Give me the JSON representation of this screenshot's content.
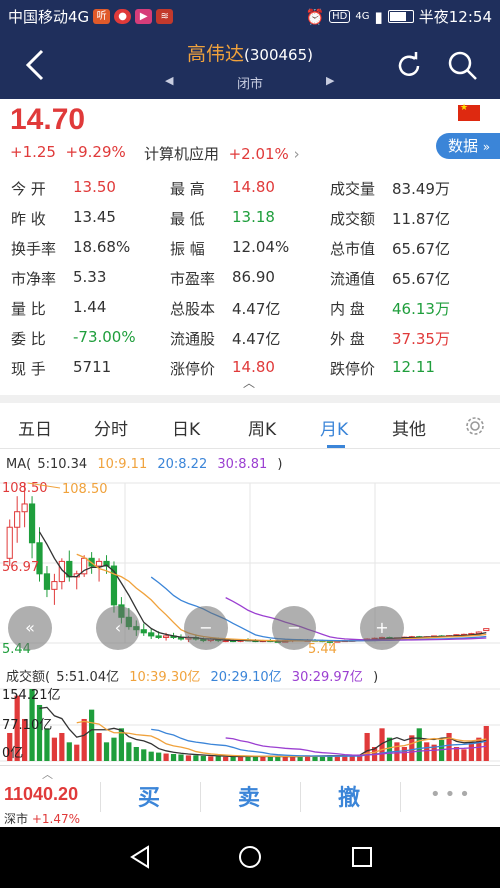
{
  "status_bar": {
    "carrier": "中国移动4G",
    "time": "半夜12:54",
    "hd": "HD",
    "net": "4G"
  },
  "header": {
    "title": "高伟达",
    "code": "(300465)",
    "market_status": "闭市"
  },
  "quote": {
    "price": "14.70",
    "change": "+1.25",
    "change_pct": "+9.29%",
    "sector_name": "计算机应用",
    "sector_pct": "+2.01%",
    "data_button": "数据"
  },
  "stats": [
    [
      {
        "label": "今 开",
        "value": "13.50",
        "color": "red"
      },
      {
        "label": "最 高",
        "value": "14.80",
        "color": "red"
      },
      {
        "label": "成交量",
        "value": "83.49万",
        "color": "none"
      }
    ],
    [
      {
        "label": "昨 收",
        "value": "13.45",
        "color": "none"
      },
      {
        "label": "最 低",
        "value": "13.18",
        "color": "green"
      },
      {
        "label": "成交额",
        "value": "11.87亿",
        "color": "none"
      }
    ],
    [
      {
        "label": "换手率",
        "value": "18.68%",
        "color": "none"
      },
      {
        "label": "振 幅",
        "value": "12.04%",
        "color": "none"
      },
      {
        "label": "总市值",
        "value": "65.67亿",
        "color": "none"
      }
    ],
    [
      {
        "label": "市净率",
        "value": "5.33",
        "color": "none"
      },
      {
        "label": "市盈率",
        "value": "86.90",
        "color": "none"
      },
      {
        "label": "流通值",
        "value": "65.67亿",
        "color": "none"
      }
    ],
    [
      {
        "label": "量 比",
        "value": "1.44",
        "color": "none"
      },
      {
        "label": "总股本",
        "value": "4.47亿",
        "color": "none"
      },
      {
        "label": "内 盘",
        "value": "46.13万",
        "color": "green"
      }
    ],
    [
      {
        "label": "委 比",
        "value": "-73.00%",
        "color": "green"
      },
      {
        "label": "流通股",
        "value": "4.47亿",
        "color": "none"
      },
      {
        "label": "外 盘",
        "value": "37.35万",
        "color": "red"
      }
    ],
    [
      {
        "label": "现 手",
        "value": "5711",
        "color": "none"
      },
      {
        "label": "涨停价",
        "value": "14.80",
        "color": "red"
      },
      {
        "label": "跌停价",
        "value": "12.11",
        "color": "green"
      }
    ]
  ],
  "tabs": [
    "五日",
    "分时",
    "日K",
    "周K",
    "月K",
    "其他"
  ],
  "active_tab": "月K",
  "ma_legend": {
    "prefix": "MA(",
    "ma5": "5:10.34",
    "ma10": "10:9.11",
    "ma20": "20:8.22",
    "ma30": "30:8.81",
    "suffix": ")"
  },
  "chart_labels": {
    "high_axis": "108.50",
    "high_mark": "108.50",
    "mid_axis": "56.97",
    "low_axis": "5.44",
    "low_mark": "5.44"
  },
  "vol_legend": {
    "prefix": "成交额(",
    "v5": "5:51.04亿",
    "v10": "10:39.30亿",
    "v20": "20:29.10亿",
    "v30": "30:29.97亿",
    "suffix": ")"
  },
  "vol_labels": {
    "top": "154.21亿",
    "mid": "77.10亿",
    "low": "0亿"
  },
  "bottom": {
    "index_value": "11040.20",
    "index_name": "深市",
    "index_pct": "+1.47%",
    "buy": "买",
    "sell": "卖",
    "cancel": "撤",
    "more": "•••"
  },
  "colors": {
    "up": "#e03a3a",
    "down": "#1f9e3c",
    "ma5": "#333333",
    "ma10": "#f0a23c",
    "ma20": "#3b85d8",
    "ma30": "#9b3fd1",
    "nav_bg": "#1f2f5c",
    "accent": "#3b85d8"
  },
  "chart_data": {
    "type": "candlestick",
    "x": [
      1,
      2,
      3,
      4,
      5,
      6,
      7,
      8,
      9,
      10,
      11,
      12,
      13,
      14,
      15,
      16,
      17,
      18,
      19,
      20,
      21,
      22,
      23,
      24,
      25,
      26,
      27,
      28,
      29,
      30,
      31,
      32,
      33,
      34,
      35,
      36,
      37,
      38,
      39,
      40,
      41,
      42,
      43,
      44,
      45,
      46,
      47,
      48,
      49,
      50,
      51,
      52,
      53,
      54,
      55,
      56,
      57,
      58,
      59,
      60,
      61,
      62,
      63,
      64,
      65
    ],
    "ohlc": [
      [
        60,
        85,
        55,
        80
      ],
      [
        80,
        100,
        70,
        90
      ],
      [
        90,
        108.5,
        80,
        95
      ],
      [
        95,
        100,
        60,
        70
      ],
      [
        70,
        80,
        45,
        50
      ],
      [
        50,
        55,
        35,
        40
      ],
      [
        40,
        50,
        30,
        45
      ],
      [
        45,
        60,
        40,
        58
      ],
      [
        58,
        65,
        45,
        48
      ],
      [
        48,
        52,
        40,
        50
      ],
      [
        50,
        62,
        48,
        60
      ],
      [
        60,
        64,
        50,
        55
      ],
      [
        55,
        60,
        45,
        58
      ],
      [
        58,
        62,
        50,
        55
      ],
      [
        55,
        58,
        25,
        30
      ],
      [
        30,
        35,
        18,
        22
      ],
      [
        22,
        28,
        14,
        16
      ],
      [
        16,
        20,
        10,
        14
      ],
      [
        14,
        18,
        10,
        12
      ],
      [
        12,
        15,
        8,
        10
      ],
      [
        10,
        13,
        8,
        9
      ],
      [
        9,
        12,
        7,
        10
      ],
      [
        10,
        12,
        8,
        9
      ],
      [
        9,
        11,
        7,
        8
      ],
      [
        8,
        10,
        6,
        9
      ],
      [
        9,
        11,
        7,
        8
      ],
      [
        8,
        9,
        6,
        7
      ],
      [
        7,
        9,
        6,
        8
      ],
      [
        8,
        9,
        6,
        7
      ],
      [
        7,
        8,
        6,
        7
      ],
      [
        7,
        8,
        6,
        6.5
      ],
      [
        6.5,
        8,
        6,
        7.5
      ],
      [
        7.5,
        8.5,
        6.5,
        7
      ],
      [
        7,
        8,
        6,
        6.5
      ],
      [
        6.5,
        7.5,
        6,
        7
      ],
      [
        7,
        8,
        6,
        6.5
      ],
      [
        6.5,
        7.5,
        5.8,
        6
      ],
      [
        6,
        7.5,
        5.8,
        7
      ],
      [
        7,
        8,
        6,
        7.5
      ],
      [
        7.5,
        8,
        6.5,
        7
      ],
      [
        7,
        8,
        6.5,
        7.2
      ],
      [
        7.2,
        8,
        6.5,
        7
      ],
      [
        7,
        7.5,
        6,
        6.5
      ],
      [
        6.5,
        7,
        5.44,
        6
      ],
      [
        6,
        7,
        5.8,
        6.8
      ],
      [
        6.8,
        7.5,
        6.2,
        7
      ],
      [
        7,
        7.5,
        6.5,
        7.2
      ],
      [
        7.2,
        8,
        6.8,
        7.5
      ],
      [
        7.5,
        8.5,
        7,
        8
      ],
      [
        8,
        9,
        7.5,
        8.5
      ],
      [
        8.5,
        9.5,
        8,
        9
      ],
      [
        9,
        9.5,
        8.2,
        8.5
      ],
      [
        8.5,
        9,
        8,
        8.8
      ],
      [
        8.8,
        9.5,
        8.5,
        9.2
      ],
      [
        9.2,
        10,
        8.8,
        9.5
      ],
      [
        9.5,
        10,
        9,
        9.2
      ],
      [
        9.2,
        9.8,
        8.8,
        9.5
      ],
      [
        9.5,
        10.2,
        9.2,
        10
      ],
      [
        10,
        10.5,
        9.5,
        9.8
      ],
      [
        9.8,
        10.5,
        9.5,
        10.2
      ],
      [
        10.2,
        11,
        10,
        10.8
      ],
      [
        10.8,
        11.5,
        10.2,
        11
      ],
      [
        11,
        12,
        10.5,
        11.5
      ],
      [
        11.5,
        13,
        11,
        12.5
      ],
      [
        13.45,
        14.8,
        13.18,
        14.7
      ]
    ],
    "volume": [
      60,
      140,
      90,
      154.21,
      120,
      70,
      50,
      60,
      40,
      35,
      90,
      110,
      60,
      40,
      50,
      70,
      40,
      30,
      25,
      20,
      18,
      16,
      15,
      14,
      12,
      12,
      11,
      10,
      10,
      9,
      9,
      10,
      11,
      10,
      9,
      10,
      9,
      9,
      10,
      11,
      12,
      11,
      10,
      12,
      11,
      12,
      13,
      14,
      60,
      30,
      70,
      50,
      40,
      30,
      55,
      70,
      40,
      35,
      45,
      60,
      30,
      25,
      40,
      50,
      75
    ]
  }
}
